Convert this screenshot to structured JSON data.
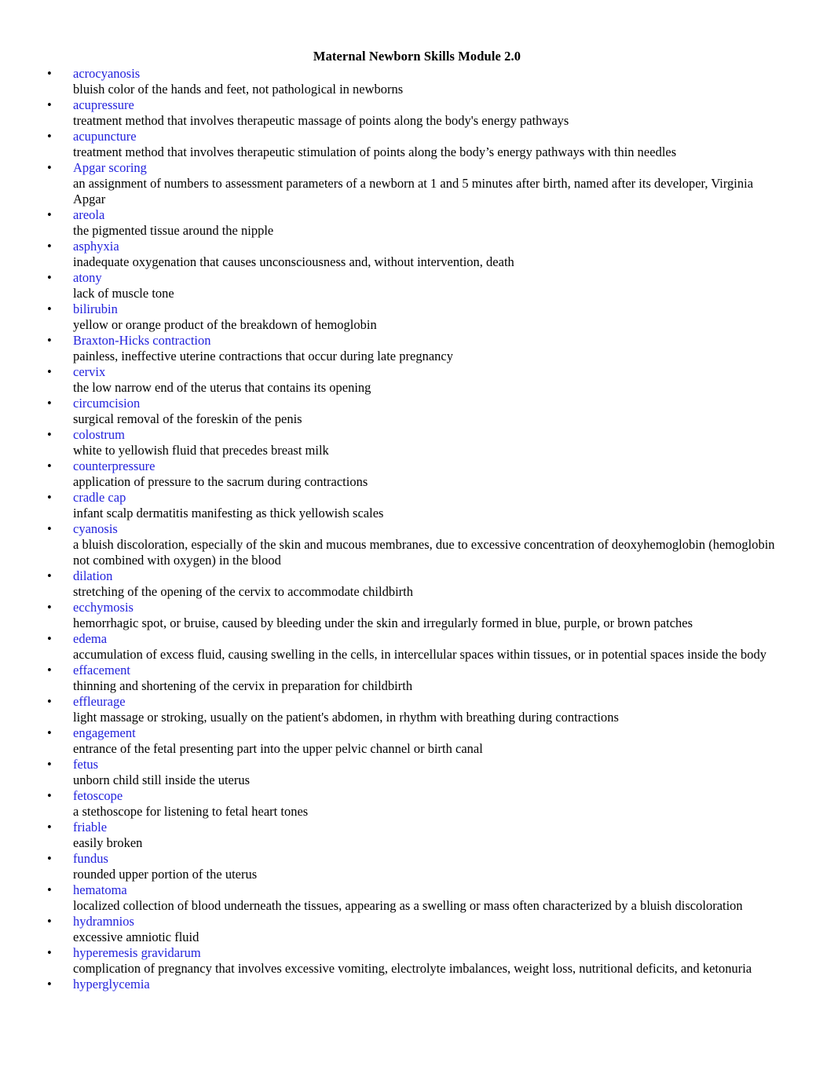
{
  "document": {
    "title": "Maternal Newborn Skills Module 2.0",
    "bullet_glyph": "•",
    "term_color": "#2222DD",
    "text_color": "#000000",
    "background_color": "#FFFFFF"
  },
  "glossary": {
    "entries": [
      {
        "term": "acrocyanosis",
        "definition": "bluish color of the hands and feet, not pathological in newborns"
      },
      {
        "term": "acupressure",
        "definition": "treatment method that involves therapeutic massage of points along the body's energy pathways"
      },
      {
        "term": "acupuncture",
        "definition": "treatment method that involves therapeutic stimulation of points along the body’s energy pathways with thin needles"
      },
      {
        "term": "Apgar scoring",
        "definition": "an assignment of numbers to assessment parameters of a newborn at 1 and 5 minutes after birth, named after its developer, Virginia Apgar"
      },
      {
        "term": "areola",
        "definition": "the pigmented tissue around the nipple"
      },
      {
        "term": "asphyxia",
        "definition": "inadequate oxygenation that causes unconsciousness and, without intervention, death"
      },
      {
        "term": "atony",
        "definition": "lack of muscle tone"
      },
      {
        "term": "bilirubin",
        "definition": "yellow or orange product of the breakdown of hemoglobin"
      },
      {
        "term": "Braxton-Hicks contraction",
        "definition": "painless, ineffective uterine contractions that occur during late pregnancy"
      },
      {
        "term": "cervix",
        "definition": "the low narrow end of the uterus that contains its opening"
      },
      {
        "term": "circumcision",
        "definition": "surgical removal of the foreskin of the penis"
      },
      {
        "term": "colostrum",
        "definition": "white to yellowish fluid that precedes breast milk"
      },
      {
        "term": "counterpressure",
        "definition": "application of pressure to the sacrum during contractions"
      },
      {
        "term": "cradle cap",
        "definition": "infant scalp dermatitis manifesting as thick yellowish scales"
      },
      {
        "term": "cyanosis",
        "definition": "a bluish discoloration, especially of the skin and mucous membranes, due to excessive concentration of deoxyhemoglobin (hemoglobin not combined with oxygen) in the blood"
      },
      {
        "term": "dilation",
        "definition": "stretching of the opening of the cervix to accommodate childbirth"
      },
      {
        "term": "ecchymosis",
        "definition": "hemorrhagic spot, or bruise, caused by bleeding under the skin and irregularly formed in blue, purple, or brown patches"
      },
      {
        "term": "edema",
        "definition": "accumulation of excess fluid, causing swelling in the cells, in intercellular spaces within tissues, or in potential spaces inside the body"
      },
      {
        "term": "effacement",
        "definition": "thinning and shortening of the cervix in preparation for childbirth"
      },
      {
        "term": "effleurage",
        "definition": "light massage or stroking, usually on the patient's abdomen, in rhythm with breathing during contractions"
      },
      {
        "term": "engagement",
        "definition": "entrance of the fetal presenting part into the upper pelvic channel or birth canal"
      },
      {
        "term": "fetus",
        "definition": "unborn child still inside the uterus"
      },
      {
        "term": "fetoscope",
        "definition": "a stethoscope for listening to fetal heart tones"
      },
      {
        "term": "friable",
        "definition": "easily broken"
      },
      {
        "term": "fundus",
        "definition": "rounded upper portion of the uterus"
      },
      {
        "term": "hematoma",
        "definition": "localized collection of blood underneath the tissues, appearing as a swelling or mass often characterized by a bluish discoloration"
      },
      {
        "term": "hydramnios",
        "definition": "excessive amniotic fluid"
      },
      {
        "term": "hyperemesis gravidarum",
        "definition": "complication of pregnancy that involves excessive vomiting, electrolyte imbalances, weight loss, nutritional deficits, and ketonuria"
      },
      {
        "term": "hyperglycemia",
        "definition": ""
      }
    ]
  }
}
